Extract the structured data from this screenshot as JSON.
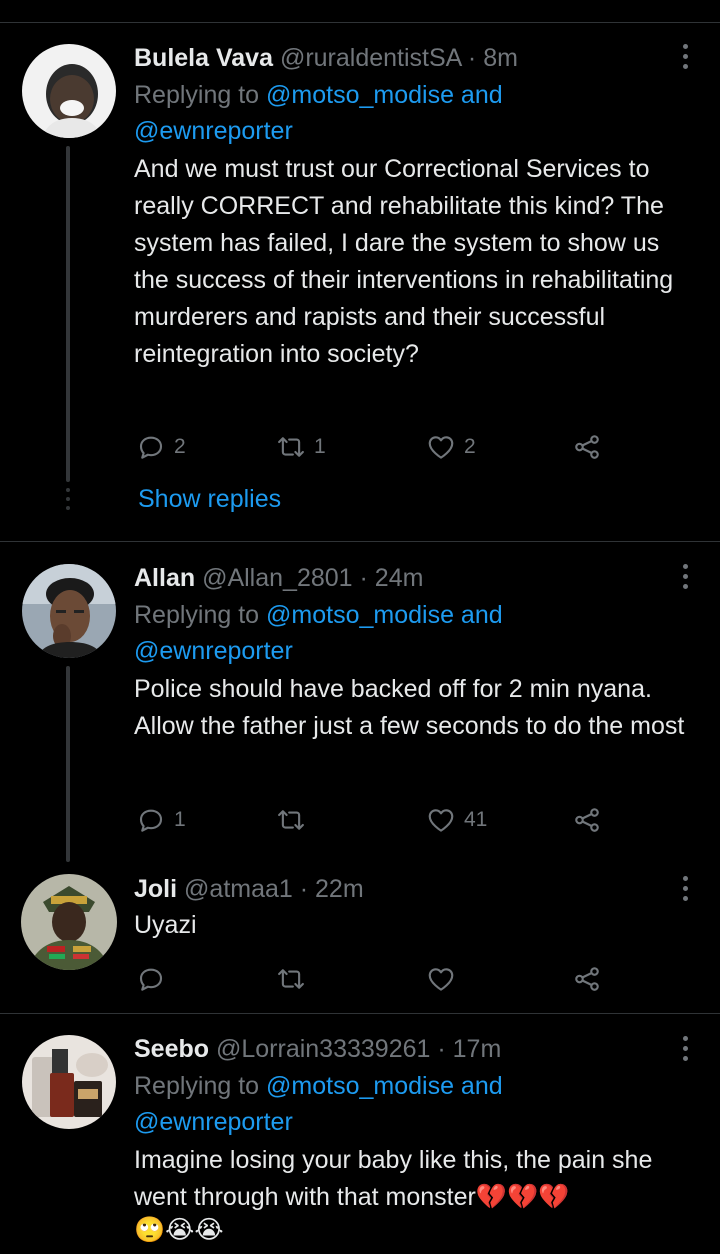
{
  "tweets": [
    {
      "name": "Bulela Vava",
      "handle": "@ruraldentistSA",
      "time": "· 8m",
      "replying_prefix": "Replying to",
      "replying_to_1": "@motso_modise and",
      "replying_to_2": "@ewnreporter",
      "text": "And we must trust our Correctional Services to really CORRECT and rehabilitate this kind? The system has failed, I dare the system to show us the success of their interventions in rehabilitating murderers and rapists and their successful reintegration into society?",
      "replies": "2",
      "retweets": "1",
      "likes": "2",
      "show_replies": "Show replies"
    },
    {
      "name": "Allan",
      "handle": "@Allan_2801",
      "time": "· 24m",
      "replying_prefix": "Replying to",
      "replying_to_1": "@motso_modise and",
      "replying_to_2": "@ewnreporter",
      "text": "Police should have backed off for 2 min nyana. Allow the father just a few seconds to do the most",
      "replies": "1",
      "retweets": "",
      "likes": "41"
    },
    {
      "name": "Joli",
      "handle": "@atmaa1",
      "time": "· 22m",
      "text": "Uyazi",
      "replies": "",
      "retweets": "",
      "likes": ""
    },
    {
      "name": "Seebo",
      "handle": "@Lorrain33339261",
      "time": "· 17m",
      "replying_prefix": "Replying to",
      "replying_to_1": "@motso_modise and",
      "replying_to_2": "@ewnreporter",
      "text": "Imagine losing your baby like this, the pain she went through with that monster💔💔💔",
      "emoji_line": "🙄😭😭"
    }
  ],
  "icons": {
    "reply": "reply-icon",
    "retweet": "retweet-icon",
    "like": "heart-icon",
    "share": "share-icon",
    "more": "more-vertical-icon"
  },
  "colors": {
    "background": "#000000",
    "text": "#e7e9ea",
    "secondary": "#71767b",
    "link": "#1d9bf0",
    "divider": "#2f3336"
  }
}
